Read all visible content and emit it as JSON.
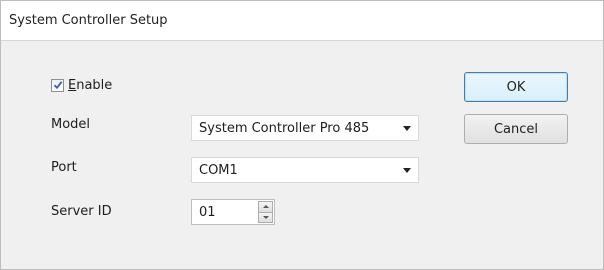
{
  "window": {
    "title": "System Controller Setup"
  },
  "enable": {
    "label_accel": "E",
    "label_rest": "nable",
    "checked": true
  },
  "model": {
    "label": "Model",
    "value": "System Controller Pro 485"
  },
  "port": {
    "label": "Port",
    "value": "COM1"
  },
  "server_id": {
    "label": "Server ID",
    "value": "01"
  },
  "buttons": {
    "ok": "OK",
    "cancel": "Cancel"
  },
  "icons": {
    "check": "checkmark-icon",
    "dropdown": "chevron-down-icon",
    "spin_up": "spin-up-icon",
    "spin_down": "spin-down-icon"
  }
}
